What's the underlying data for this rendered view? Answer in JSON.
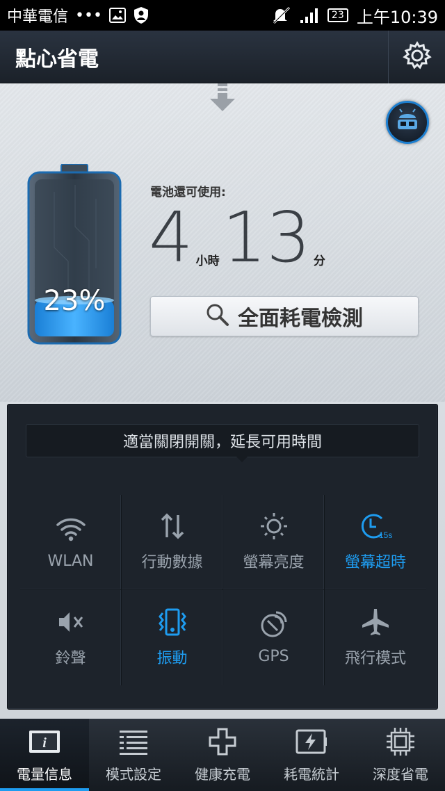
{
  "status_bar": {
    "carrier": "中華電信",
    "dots": "•••",
    "calendar_day": "23",
    "time": "上午10:39"
  },
  "app_bar": {
    "title": "點心省電"
  },
  "battery": {
    "percent_label": "23%",
    "level": 0.23,
    "remaining_label": "電池還可使用:",
    "hours": "4",
    "hours_unit": "小時",
    "minutes": "13",
    "minutes_unit": "分"
  },
  "scan_button": {
    "label": "全面耗電檢測"
  },
  "tip": {
    "text": "適當關閉開關，延長可用時間"
  },
  "toggles": [
    {
      "label": "WLAN",
      "icon": "wifi-icon",
      "active": false
    },
    {
      "label": "行動數據",
      "icon": "mobile-data-icon",
      "active": false
    },
    {
      "label": "螢幕亮度",
      "icon": "brightness-icon",
      "active": false
    },
    {
      "label": "螢幕超時",
      "icon": "screen-timeout-icon",
      "active": true,
      "badge": "15s"
    },
    {
      "label": "鈴聲",
      "icon": "ringer-icon",
      "active": false
    },
    {
      "label": "振動",
      "icon": "vibrate-icon",
      "active": true
    },
    {
      "label": "GPS",
      "icon": "gps-icon",
      "active": false
    },
    {
      "label": "飛行模式",
      "icon": "airplane-icon",
      "active": false
    }
  ],
  "bottom_nav": [
    {
      "label": "電量信息",
      "icon": "info-icon",
      "active": true
    },
    {
      "label": "模式設定",
      "icon": "list-icon",
      "active": false
    },
    {
      "label": "健康充電",
      "icon": "plus-icon",
      "active": false
    },
    {
      "label": "耗電統計",
      "icon": "battery-charge-icon",
      "active": false
    },
    {
      "label": "深度省電",
      "icon": "chip-icon",
      "active": false
    }
  ],
  "colors": {
    "accent": "#1e9cf0",
    "dark_panel": "#1d232b",
    "inactive_text": "#9aa3ad"
  }
}
